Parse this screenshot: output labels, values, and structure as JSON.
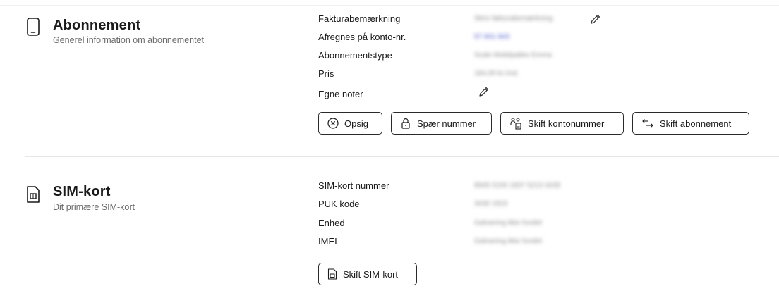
{
  "abonnement": {
    "title": "Abonnement",
    "subtitle": "Generel information om abonnementet",
    "icon": "phone-icon",
    "rows": [
      {
        "label": "Fakturabemærkning",
        "value": "Skriv fakturabemærkning",
        "editable": true
      },
      {
        "label": "Afregnes på konto-nr.",
        "value": "57 601 843",
        "link": true
      },
      {
        "label": "Abonnementstype",
        "value": "Scale Mobilpakke Emma"
      },
      {
        "label": "Pris",
        "value": "184,00 kr./md."
      },
      {
        "label": "Egne noter",
        "value": "",
        "editable": true
      }
    ],
    "buttons": {
      "opsig": "Opsig",
      "spaer": "Spær nummer",
      "skift_konto": "Skift kontonummer",
      "skift_abonnement": "Skift abonnement"
    }
  },
  "sim": {
    "title": "SIM-kort",
    "subtitle": "Dit primære SIM-kort",
    "icon": "sim-card-icon",
    "rows": [
      {
        "label": "SIM-kort nummer",
        "value": "8945 0100 1837 5213 3435"
      },
      {
        "label": "PUK kode",
        "value": "3430 1915"
      },
      {
        "label": "Enhed",
        "value": "Galvaning ikke fundet"
      },
      {
        "label": "IMEI",
        "value": "Galvaning ikke fundet"
      }
    ],
    "buttons": {
      "skift_sim": "Skift SIM-kort"
    }
  }
}
